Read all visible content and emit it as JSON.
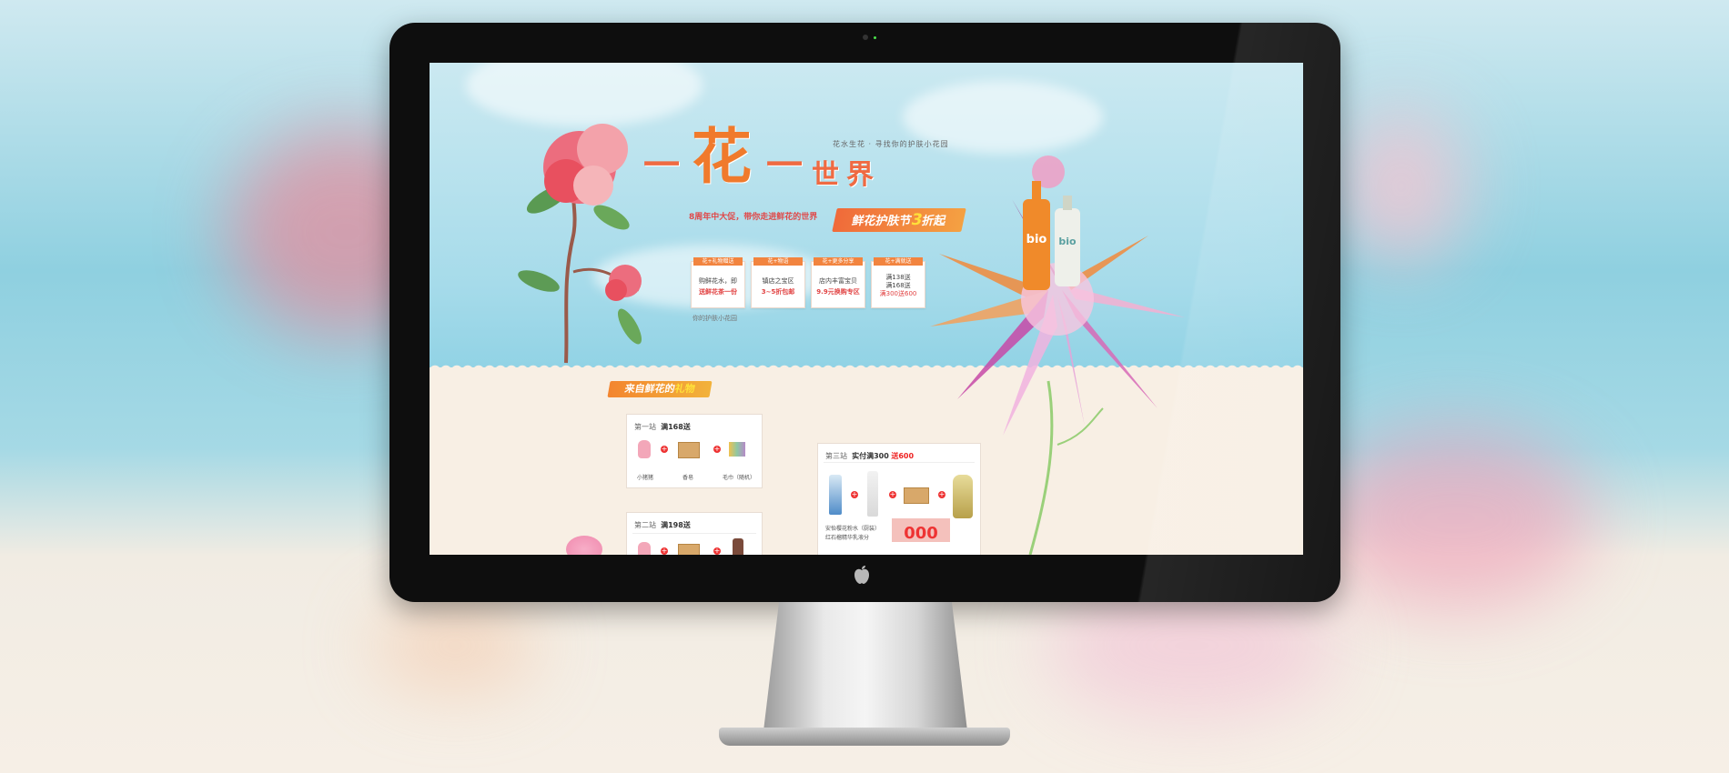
{
  "background": {
    "top_color": "#9bd4e3",
    "bottom_color": "#f4ede3"
  },
  "monitor": {
    "bezel_color": "#0e0e0e",
    "logo": "apple-logo-icon"
  },
  "page": {
    "header": {
      "tagline": "花水生花 · 寻找你的护肤小花园",
      "title_chars": [
        "一",
        "花",
        "一",
        "世",
        "界"
      ],
      "subline": "8周年中大促，带你走进鲜花的世界",
      "sale_banner": {
        "prefix": "鲜花护肤节",
        "highlight": "3",
        "suffix": "折起"
      }
    },
    "feature_cards": [
      {
        "tag": "花+礼物赠送",
        "line1": "购鲜花水，即",
        "line2": "送鲜花茶一份"
      },
      {
        "tag": "花+物语",
        "line1": "镇店之宝区",
        "line2": "3~5折包邮"
      },
      {
        "tag": "花+更多分享",
        "line1": "店内丰富宝贝",
        "line2": "9.9元换购专区"
      },
      {
        "tag": "花+满就送",
        "lines": [
          "满138送",
          "满168送",
          "满300送600"
        ]
      }
    ],
    "footer_note": "你的护肤小花园",
    "gift_section": {
      "banner": {
        "prefix": "来自鲜花的",
        "highlight": "礼物"
      },
      "stage1": {
        "label": "第一站",
        "condition": "满168送",
        "items": [
          "小猪猪",
          "香皂",
          "毛巾（随机）"
        ]
      },
      "stage2": {
        "label": "第二站",
        "condition": "满198送"
      },
      "stage3": {
        "label": "第三站",
        "condition": "实付满300",
        "bonus": "送600",
        "caption_line1": "安怡樱花粉水（厨装）",
        "caption_line2": "红石榴精华乳液分",
        "price": "000"
      }
    },
    "product_brand": "bio"
  }
}
